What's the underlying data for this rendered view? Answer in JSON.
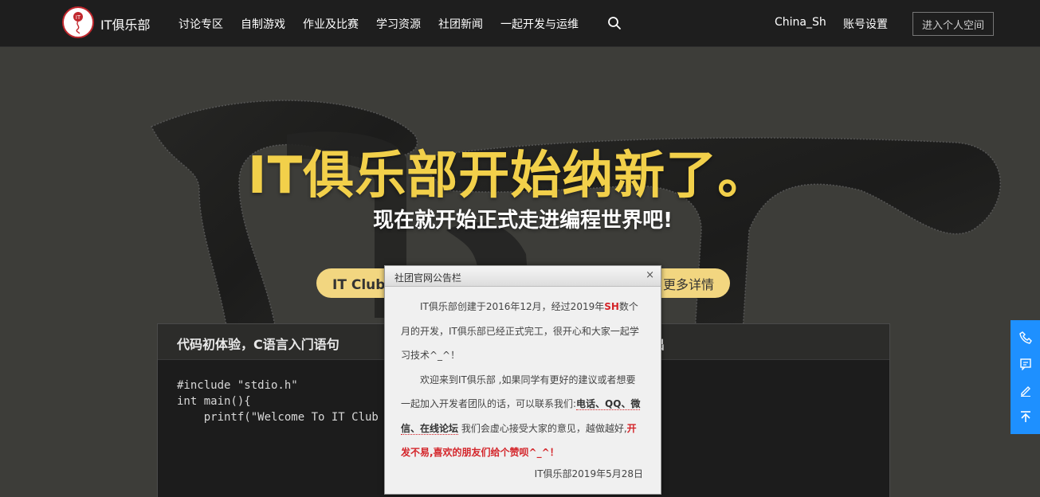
{
  "nav": {
    "brand": "IT俱乐部",
    "items": [
      "讨论专区",
      "自制游戏",
      "作业及比赛",
      "学习资源",
      "社团新闻",
      "一起开发与运维"
    ],
    "user": "China_Sh",
    "settings": "账号设置",
    "space_button": "进入个人空间",
    "icons": {
      "search": "search-icon"
    }
  },
  "hero": {
    "title": "IT俱乐部开始纳新了。",
    "subtitle": "现在就开始正式走进编程世界吧!",
    "btn_left": "IT Club正",
    "btn_right": "更多详情"
  },
  "code_panel": {
    "title": "代码初体验，C语言入门语句",
    "title_right": "出",
    "code": "#include \"stdio.h\"\nint main(){\n    printf(\"Welcome To IT Club"
  },
  "modal": {
    "title": "社团官网公告栏",
    "close": "×",
    "p1_a": "IT俱乐部创建于2016年12月，经过2019年",
    "p1_sh": "SH",
    "p1_b": "数个月的开发，IT俱乐部已经正式完工，很开心和大家一起学习技术^_^！",
    "p2_a": "欢迎来到IT俱乐部 ,如果同学有更好的建议或者想要一起加入开发者团队的话，可以联系我们:",
    "p2_links": "电话、QQ、微信、在线论坛",
    "p2_b": " 我们会虚心接受大家的意见，越做越好,",
    "p2_red": "开发不易,喜欢的朋友们给个赞呗^_^！",
    "date": "IT俱乐部2019年5月28日"
  },
  "side_bar": {
    "icons": [
      "phone-icon",
      "message-icon",
      "edit-icon",
      "back-to-top-icon"
    ]
  },
  "colors": {
    "nav_bg": "#1e1e1e",
    "hero_bg": "#3d3d39",
    "title_yellow": "#f2d04a",
    "button_yellow": "#f2d680",
    "accent_red": "#d4252a",
    "side_blue": "#1e90ff"
  }
}
